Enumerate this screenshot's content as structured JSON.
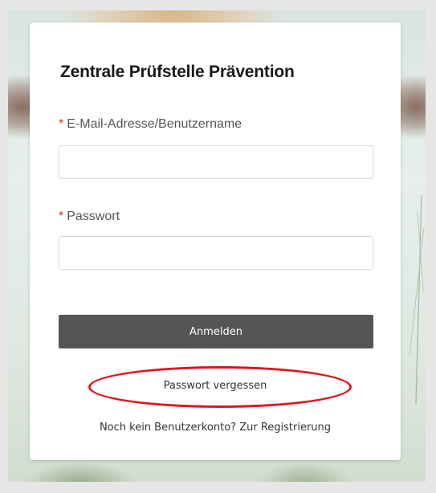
{
  "login": {
    "title": "Zentrale Prüfstelle Prävention",
    "required_marker": "*",
    "email_label": "E-Mail-Adresse/Benutzername",
    "email_value": "",
    "password_label": "Passwort",
    "password_value": "",
    "submit_label": "Anmelden",
    "forgot_label": "Passwort vergessen",
    "register_prompt": "Noch kein Benutzerkonto?",
    "register_link": "Zur Registrierung"
  },
  "colors": {
    "button_bg": "#555555",
    "required": "#c0392b",
    "annotation": "#e0141e"
  }
}
